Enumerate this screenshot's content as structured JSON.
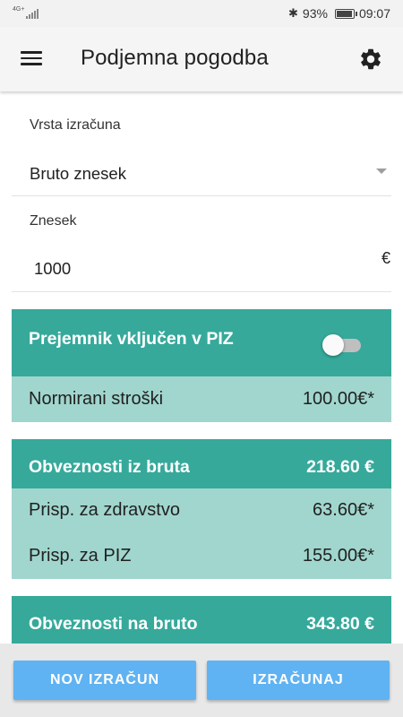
{
  "status_bar": {
    "network": "4G+",
    "battery_percent": "93%",
    "battery_level": 0.93,
    "time": "09:07"
  },
  "app_bar": {
    "title": "Podjemna pogodba",
    "menu_icon": "hamburger-menu-icon",
    "settings_icon": "gear-icon"
  },
  "form": {
    "calc_type_label": "Vrsta izračuna",
    "calc_type_value": "Bruto znesek",
    "amount_label": "Znesek",
    "amount_value": "1000",
    "currency": "€"
  },
  "piz_card": {
    "title": "Prejemnik vključen v PIZ",
    "toggle_on": false,
    "row_label": "Normirani stroški",
    "row_value": "100.00€*"
  },
  "gross_obligations_card": {
    "title": "Obveznosti iz bruta",
    "total": "218.60 €",
    "rows": [
      {
        "label": "Prisp. za zdravstvo",
        "value": "63.60€*"
      },
      {
        "label": "Prisp. za PIZ",
        "value": "155.00€*"
      }
    ]
  },
  "on_gross_card": {
    "title": "Obveznosti na bruto",
    "total": "343.80 €"
  },
  "buttons": {
    "new_calc": "NOV IZRAČUN",
    "calculate": "IZRAČUNAJ"
  },
  "colors": {
    "card_header": "#36a99b",
    "card_body": "#a0d6ce",
    "button": "#5fb3f2"
  }
}
